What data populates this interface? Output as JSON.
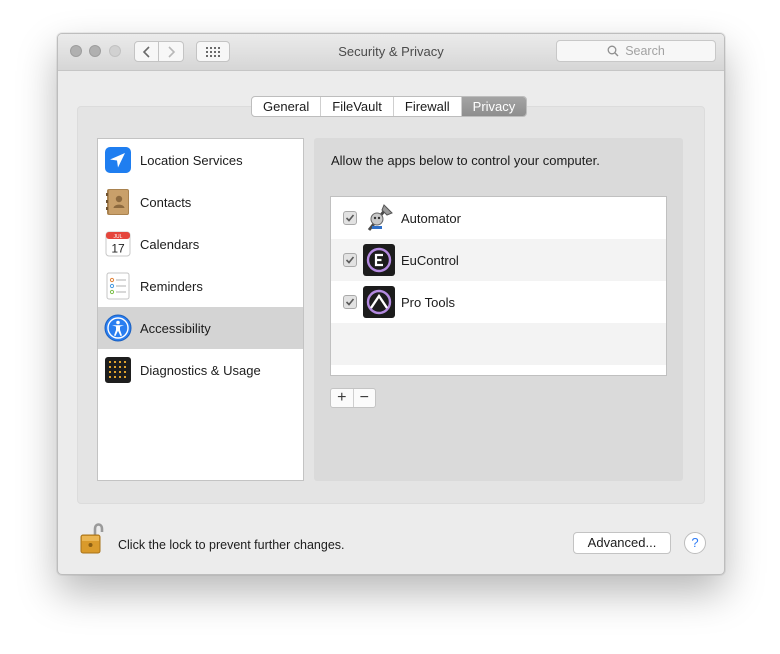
{
  "window": {
    "title": "Security & Privacy"
  },
  "search": {
    "placeholder": "Search"
  },
  "tabs": [
    {
      "label": "General"
    },
    {
      "label": "FileVault"
    },
    {
      "label": "Firewall"
    },
    {
      "label": "Privacy",
      "selected": true
    }
  ],
  "sidebar": {
    "items": [
      {
        "label": "Location Services",
        "icon": "location-arrow-icon"
      },
      {
        "label": "Contacts",
        "icon": "contacts-book-icon"
      },
      {
        "label": "Calendars",
        "icon": "calendar-icon",
        "icon_month": "JUL",
        "icon_day": "17"
      },
      {
        "label": "Reminders",
        "icon": "reminders-list-icon"
      },
      {
        "label": "Accessibility",
        "icon": "accessibility-person-icon",
        "selected": true
      },
      {
        "label": "Diagnostics & Usage",
        "icon": "diagnostics-grid-icon"
      }
    ]
  },
  "main": {
    "instruction": "Allow the apps below to control your computer.",
    "apps": [
      {
        "name": "Automator",
        "checked": true,
        "icon": "automator-robot-icon"
      },
      {
        "name": "EuControl",
        "checked": true,
        "icon": "eucontrol-e-icon"
      },
      {
        "name": "Pro Tools",
        "checked": true,
        "icon": "pro-tools-icon"
      }
    ],
    "add_label": "+",
    "remove_label": "−"
  },
  "footer": {
    "lock_text": "Click the lock to prevent further changes.",
    "advanced_label": "Advanced...",
    "help_label": "?"
  },
  "colors": {
    "tab_selected": "#999999",
    "selection_row": "#d4d4d4",
    "help_blue": "#2f7cf6",
    "lock_gold": "#d99a2b"
  }
}
